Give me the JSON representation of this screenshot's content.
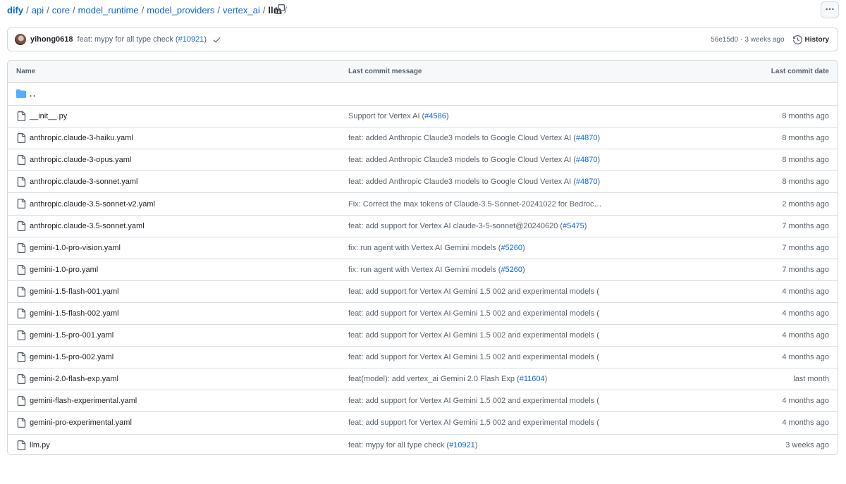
{
  "breadcrumb": {
    "segments": [
      "dify",
      "api",
      "core",
      "model_runtime",
      "model_providers",
      "vertex_ai"
    ],
    "current": "llm",
    "separator": "/"
  },
  "commit_bar": {
    "author": "yihong0618",
    "message_prefix": "feat: mypy for all type check (",
    "message_link": "#10921",
    "message_suffix": ")",
    "sha": "56e15d0",
    "dot": "·",
    "time": "3 weeks ago",
    "history_label": "History"
  },
  "table": {
    "headers": {
      "name": "Name",
      "message": "Last commit message",
      "date": "Last commit date"
    },
    "parent": "..",
    "rows": [
      {
        "name": "__init__.py",
        "msg": "Support for Vertex AI (",
        "pr": "#4586",
        "tail": ")",
        "date": "8 months ago"
      },
      {
        "name": "anthropic.claude-3-haiku.yaml",
        "msg": "feat: added Anthropic Claude3 models to Google Cloud Vertex AI (",
        "pr": "#4870",
        "tail": ")",
        "date": "8 months ago"
      },
      {
        "name": "anthropic.claude-3-opus.yaml",
        "msg": "feat: added Anthropic Claude3 models to Google Cloud Vertex AI (",
        "pr": "#4870",
        "tail": ")",
        "date": "8 months ago"
      },
      {
        "name": "anthropic.claude-3-sonnet.yaml",
        "msg": "feat: added Anthropic Claude3 models to Google Cloud Vertex AI (",
        "pr": "#4870",
        "tail": ")",
        "date": "8 months ago"
      },
      {
        "name": "anthropic.claude-3.5-sonnet-v2.yaml",
        "msg": "Fix: Correct the max tokens of Claude-3.5-Sonnet-20241022 for Bedrock…",
        "pr": "",
        "tail": "",
        "date": "2 months ago"
      },
      {
        "name": "anthropic.claude-3.5-sonnet.yaml",
        "msg": "feat: add support for Vertex AI claude-3-5-sonnet@20240620 (",
        "pr": "#5475",
        "tail": ")",
        "date": "7 months ago"
      },
      {
        "name": "gemini-1.0-pro-vision.yaml",
        "msg": "fix: run agent with Vertex AI Gemini models (",
        "pr": "#5260",
        "tail": ")",
        "date": "7 months ago"
      },
      {
        "name": "gemini-1.0-pro.yaml",
        "msg": "fix: run agent with Vertex AI Gemini models (",
        "pr": "#5260",
        "tail": ")",
        "date": "7 months ago"
      },
      {
        "name": "gemini-1.5-flash-001.yaml",
        "msg": "feat: add support for Vertex AI Gemini 1.5 002 and experimental models (",
        "pr": "",
        "tail": "",
        "date": "4 months ago"
      },
      {
        "name": "gemini-1.5-flash-002.yaml",
        "msg": "feat: add support for Vertex AI Gemini 1.5 002 and experimental models (",
        "pr": "",
        "tail": "",
        "date": "4 months ago"
      },
      {
        "name": "gemini-1.5-pro-001.yaml",
        "msg": "feat: add support for Vertex AI Gemini 1.5 002 and experimental models (",
        "pr": "",
        "tail": "",
        "date": "4 months ago"
      },
      {
        "name": "gemini-1.5-pro-002.yaml",
        "msg": "feat: add support for Vertex AI Gemini 1.5 002 and experimental models (",
        "pr": "",
        "tail": "",
        "date": "4 months ago"
      },
      {
        "name": "gemini-2.0-flash-exp.yaml",
        "msg": "feat(model): add vertex_ai Gemini 2.0 Flash Exp (",
        "pr": "#11604",
        "tail": ")",
        "date": "last month"
      },
      {
        "name": "gemini-flash-experimental.yaml",
        "msg": "feat: add support for Vertex AI Gemini 1.5 002 and experimental models (",
        "pr": "",
        "tail": "",
        "date": "4 months ago"
      },
      {
        "name": "gemini-pro-experimental.yaml",
        "msg": "feat: add support for Vertex AI Gemini 1.5 002 and experimental models (",
        "pr": "",
        "tail": "",
        "date": "4 months ago"
      },
      {
        "name": "llm.py",
        "msg": "feat: mypy for all type check (",
        "pr": "#10921",
        "tail": ")",
        "date": "3 weeks ago"
      }
    ]
  },
  "icons": {
    "copy": "copy-icon",
    "more": "kebab-horizontal-icon",
    "check": "check-icon",
    "history": "history-icon",
    "folder": "folder-icon",
    "file": "file-icon"
  },
  "colors": {
    "link": "#0969da",
    "muted": "#59636e",
    "folder": "#54aeff",
    "check": "#59636e"
  }
}
